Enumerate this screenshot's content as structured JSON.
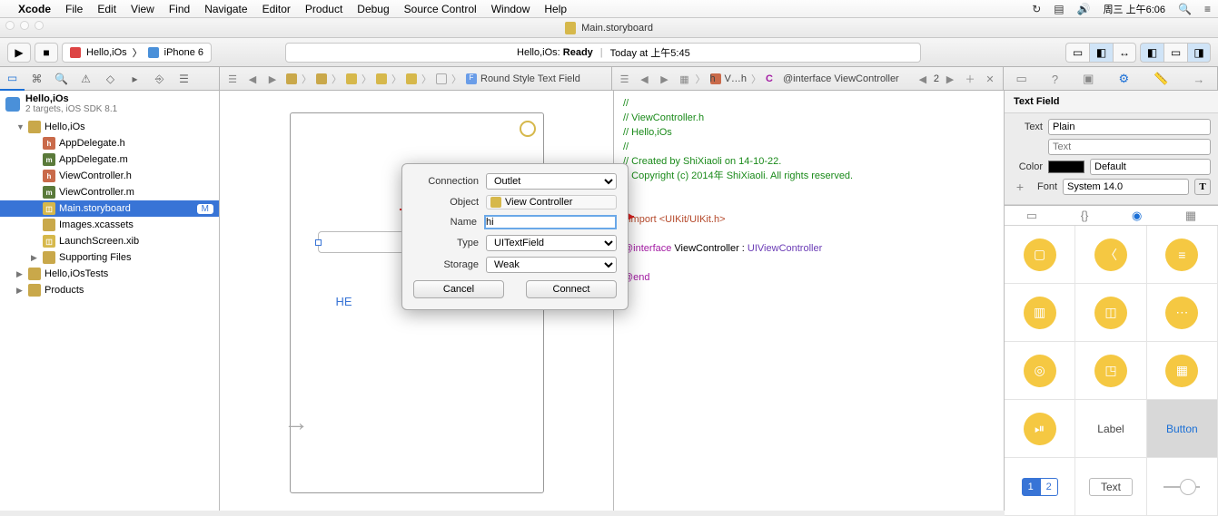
{
  "menubar": {
    "app": "Xcode",
    "items": [
      "File",
      "Edit",
      "View",
      "Find",
      "Navigate",
      "Editor",
      "Product",
      "Debug",
      "Source Control",
      "Window",
      "Help"
    ],
    "clock": "周三 上午6:06"
  },
  "titlebar": {
    "doc": "Main.storyboard"
  },
  "toolbar": {
    "scheme_app": "Hello,iOs",
    "scheme_device": "iPhone 6",
    "activity_app": "Hello,iOs",
    "activity_status": "Ready",
    "activity_time": "Today at 上午5:45"
  },
  "jumpbar_left": {
    "field": "Round Style Text Field"
  },
  "jumpbar_right": {
    "file": "V…h",
    "symbol": "@interface ViewController",
    "counter": "2"
  },
  "navigator": {
    "project": "Hello,iOs",
    "subtitle": "2 targets, iOS SDK 8.1",
    "group1": "Hello,iOs",
    "files": [
      {
        "name": "AppDelegate.h",
        "t": "h"
      },
      {
        "name": "AppDelegate.m",
        "t": "m"
      },
      {
        "name": "ViewController.h",
        "t": "h"
      },
      {
        "name": "ViewController.m",
        "t": "m"
      },
      {
        "name": "Main.storyboard",
        "t": "sb",
        "sel": true,
        "badge": "M"
      },
      {
        "name": "Images.xcassets",
        "t": "folder"
      },
      {
        "name": "LaunchScreen.xib",
        "t": "xib"
      }
    ],
    "group_sup": "Supporting Files",
    "group2": "Hello,iOsTests",
    "group3": "Products"
  },
  "canvas": {
    "label": "HE"
  },
  "popover": {
    "labels": {
      "connection": "Connection",
      "object": "Object",
      "name": "Name",
      "type": "Type",
      "storage": "Storage"
    },
    "connection": "Outlet",
    "object": "View Controller",
    "name": "hi",
    "type": "UITextField",
    "storage": "Weak",
    "cancel": "Cancel",
    "connect": "Connect"
  },
  "code": {
    "l1": "//",
    "l2": "//  ViewController.h",
    "l3": "//  Hello,iOs",
    "l4": "//",
    "l5": "//  Created by ShiXiaoli on 14-10-22.",
    "l6": "//  Copyright (c) 2014年 ShiXiaoli. All rights reserved.",
    "l7": "//",
    "l8a": "#import ",
    "l8b": "<UIKit/UIKit.h>",
    "l9a": "@interface",
    "l9b": " ViewController : ",
    "l9c": "UIViewController",
    "l10": "@end"
  },
  "inspector": {
    "title": "Text Field",
    "text_label": "Text",
    "text_style": "Plain",
    "text_placeholder": "Text",
    "color_label": "Color",
    "color_value": "Default",
    "font_label": "Font",
    "font_value": "System 14.0"
  },
  "library": {
    "label": "Label",
    "button": "Button",
    "text": "Text",
    "seg1": "1",
    "seg2": "2"
  }
}
